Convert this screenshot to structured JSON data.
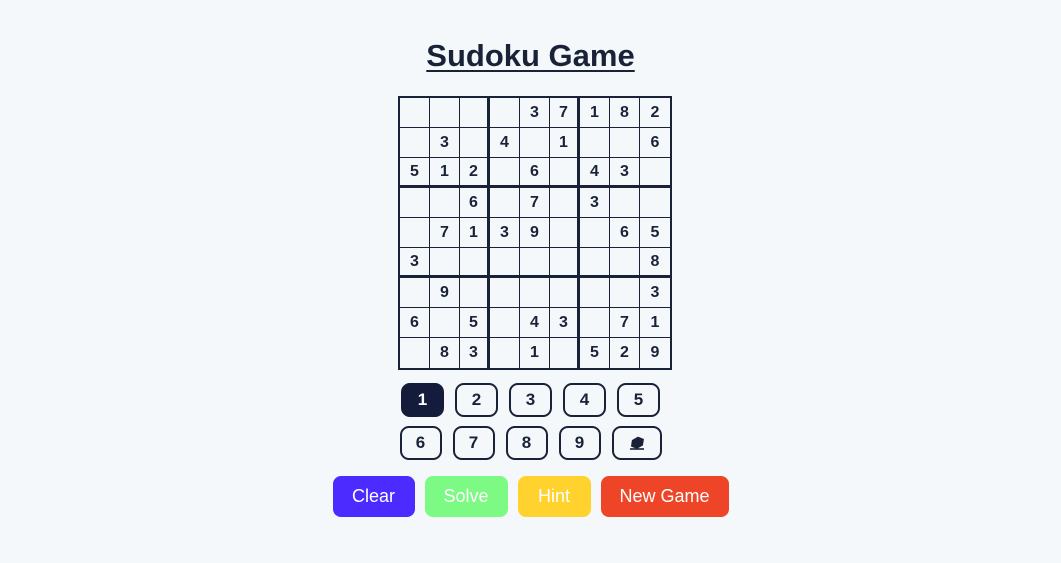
{
  "title": "Sudoku Game",
  "grid": [
    [
      "",
      "",
      "",
      "",
      "3",
      "7",
      "1",
      "8",
      "2"
    ],
    [
      "",
      "3",
      "",
      "4",
      "",
      "1",
      "",
      "",
      "6"
    ],
    [
      "5",
      "1",
      "2",
      "",
      "6",
      "",
      "4",
      "3",
      ""
    ],
    [
      "",
      "",
      "6",
      "",
      "7",
      "",
      "3",
      "",
      ""
    ],
    [
      "",
      "7",
      "1",
      "3",
      "9",
      "",
      "",
      "6",
      "5"
    ],
    [
      "3",
      "",
      "",
      "",
      "",
      "",
      "",
      "",
      "8"
    ],
    [
      "",
      "9",
      "",
      "",
      "",
      "",
      "",
      "",
      "3"
    ],
    [
      "6",
      "",
      "5",
      "",
      "4",
      "3",
      "",
      "7",
      "1"
    ],
    [
      "",
      "8",
      "3",
      "",
      "1",
      "",
      "5",
      "2",
      "9"
    ]
  ],
  "number_pad": {
    "row1": [
      "1",
      "2",
      "3",
      "4",
      "5"
    ],
    "row2": [
      "6",
      "7",
      "8",
      "9"
    ],
    "selected": "1",
    "erase_icon": "eraser-icon"
  },
  "actions": {
    "clear_label": "Clear",
    "solve_label": "Solve",
    "hint_label": "Hint",
    "new_game_label": "New Game"
  },
  "colors": {
    "background": "#f5f8fb",
    "ink": "#1a2238",
    "selected_number": "#141c3c",
    "clear": "#4b2bff",
    "solve": "#7cfa84",
    "hint": "#ffd22e",
    "new_game": "#ee4528"
  }
}
